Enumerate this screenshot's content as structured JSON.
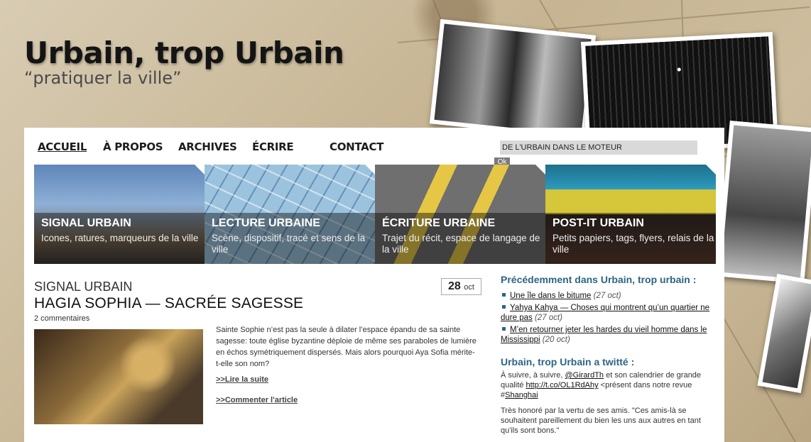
{
  "site": {
    "title": "Urbain, trop Urbain",
    "tagline": "“pratiquer la ville”"
  },
  "nav": {
    "items": [
      "ACCUEIL",
      "À PROPOS",
      "ARCHIVES",
      "ÉCRIRE",
      "CONTACT"
    ],
    "search_value": "DE L'URBAIN DANS LE MOTEUR",
    "search_button": "Ok"
  },
  "tiles": [
    {
      "title": "SIGNAL URBAIN",
      "desc": "Icones, ratures, marqueurs de la ville"
    },
    {
      "title": "LECTURE URBAINE",
      "desc": "Scène, dispositif, tracé et sens de la ville"
    },
    {
      "title": "ÉCRITURE URBAINE",
      "desc": "Trajet du récit, espace de langage de la ville"
    },
    {
      "title": "POST-IT URBAIN",
      "desc": "Petits papiers, tags, flyers, relais de la ville"
    }
  ],
  "post": {
    "category": "SIGNAL URBAIN",
    "title": "HAGIA SOPHIA — SACRÉE SAGESSE",
    "comments": "2 commentaires",
    "date_day": "28",
    "date_month": "oct",
    "excerpt": "Sainte Sophie n’est pas la seule à dilater l’espace épandu de sa sainte sagesse: toute église byzantine déploie de même ses paraboles de lumière en échos symétriquement dispersés. Mais alors pourquoi Aya Sofia mérite-t-elle son nom?",
    "read_more": ">>Lire la suite",
    "comment_link": ">>Commenter l'article"
  },
  "sidebar": {
    "previous_heading": "Précédemment dans Urbain, trop urbain :",
    "previous": [
      {
        "title": "Une île dans le bitume",
        "date": "(27 oct)"
      },
      {
        "title": "Yahya Kahya — Choses qui montrent qu’un quartier ne dure pas",
        "date": "(27 oct)"
      },
      {
        "title": "M’en retourner jeter les hardes du vieil homme dans le Mississippi",
        "date": "(20 oct)"
      }
    ],
    "tweet_heading": "Urbain, trop Urbain a twitté :",
    "tweet1": {
      "pre": "À suivre, à suivre, ",
      "handle": "@GirardTh",
      "mid": " et son calendrier de grande qualité ",
      "link": "http://t.co/OL1RdAhy",
      "post": " <présent dans notre revue #",
      "tag": "Shanghai"
    },
    "tweet2": "Très honoré par la vertu de ses amis. \"Ces amis-là se souhaitent pareillement du bien les uns aux autres en tant qu'ils sont bons.\""
  }
}
